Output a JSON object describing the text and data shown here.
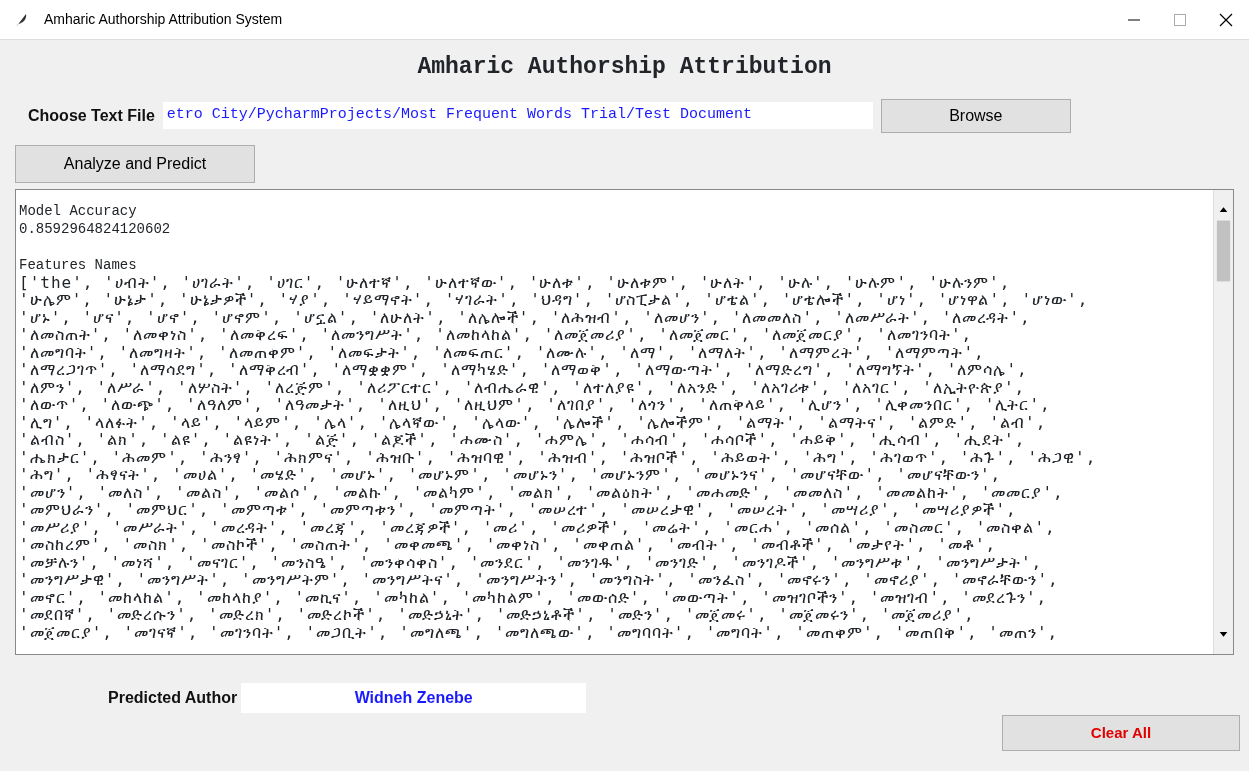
{
  "window": {
    "title": "Amharic Authorship Attribution System"
  },
  "heading": "Amharic Authorship Attribution",
  "file_row": {
    "label": "Choose Text File",
    "value": "etro City/PycharmProjects/Most Frequent Words Trial/Test Document",
    "button": "Browse"
  },
  "analyze_button": "Analyze and Predict",
  "output": [
    {
      "heading": "Model Accuracy",
      "lines": [
        "0.8592964824120602"
      ]
    },
    {
      "heading": "Features Names",
      "lines": [
        "['the', 'ሀብት', 'ሀገራት', 'ሀገር', 'ሁለተኛ', 'ሁለተኛው', 'ሁለቱ', 'ሁለቱም', 'ሁለት', 'ሁሉ', 'ሁሉም', 'ሁሉንም',",
        "'ሁሌም', 'ሁኔታ', 'ሁኔታዎች', 'ሃያ', 'ሃይማኖት', 'ሃገራት', 'ህዳግ', 'ሆስፒታል', 'ሆቴል', 'ሆቴሎች', 'ሆነ', 'ሆነዋል', 'ሆነው',",
        "'ሆኑ', 'ሆና', 'ሆኖ', 'ሆኖም', 'ሆኗል', 'ለሁለት', 'ለሌሎች', 'ለሕዝብ', 'ለመሆን', 'ለመመለስ', 'ለመሥራት', 'ለመረዳት',",
        "'ለመስጠት', 'ለመቀነስ', 'ለመቅረፍ', 'ለመንግሥት', 'ለመከላከል', 'ለመጀመሪያ', 'ለመጀመር', 'ለመጀመርያ', 'ለመገንባት',",
        "'ለመግባት', 'ለመግዛት', 'ለመጠቀም', 'ለመፍታት', 'ለመፍጠር', 'ለሙሉ', 'ለማ', 'ለማለት', 'ለማምረት', 'ለማምጣት',",
        "'ለማረጋገጥ', 'ለማሳደግ', 'ለማቅረብ', 'ለማቋቋም', 'ለማካሄድ', 'ለማወቅ', 'ለማውጣት', 'ለማድረግ', 'ለማግኘት', 'ለምሳሌ',",
        "'ለምን', 'ለሥራ', 'ለሦስት', 'ለረጅም', 'ለሪፖርተር', 'ለብሔራዊ', 'ለተለያዩ', 'ለአንድ', 'ለአገሪቱ', 'ለአገር', 'ለኢትዮጵያ',",
        "'ለውጥ', 'ለውጭ', 'ለዓለም', 'ለዓመታት', 'ለዚህ', 'ለዚህም', 'ለገበያ', 'ለጎን', 'ለጠቅላይ', 'ሊሆን', 'ሊቀመንበር', 'ሊትር',",
        "'ሊግ', 'ላለፉት', 'ላይ', 'ላይም', 'ሌላ', 'ሌላኛው', 'ሌላው', 'ሌሎች', 'ሌሎችም', 'ልማት', 'ልማትና', 'ልምድ', 'ልብ',",
        "'ልብስ', 'ልክ', 'ልዩ', 'ልዩነት', 'ልጅ', 'ልጆች', 'ሐሙስ', 'ሐምሌ', 'ሐሳብ', 'ሐሳቦች', 'ሐይቅ', 'ሒሳብ', 'ሒደት',",
        "'ሔክታር', 'ሕመም', 'ሕንፃ', 'ሕክምና', 'ሕዝቡ', 'ሕዝባዊ', 'ሕዝብ', 'ሕዝቦች', 'ሕይወት', 'ሕግ', 'ሕገወጥ', 'ሕጉ', 'ሕጋዊ',",
        "'ሕግ', 'ሕፃናት', 'መሀል', 'መሄድ', 'መሆኑ', 'መሆኑም', 'መሆኑን', 'መሆኑንም', 'መሆኑንና', 'መሆናቸው', 'መሆናቸውን',",
        "'መሆን', 'መለስ', 'መልስ', 'መልሶ', 'መልኩ', 'መልካም', 'መልክ', 'መልዕክት', 'መሐመድ', 'መመለስ', 'መመልከት', 'መመርያ',",
        "'መምህራን', 'መምህር', 'መምጣቱ', 'መምጣቱን', 'መምጣት', 'መሠረተ', 'መሠረታዊ', 'መሠረት', 'መሣሪያ', 'መሣሪያዎች',",
        "'መሥሪያ', 'መሥራት', 'መረዳት', 'መረጃ', 'መረጃዎች', 'መሪ', 'መሪዎች', 'መሬት', 'መርሐ', 'መሰል', 'መስመር', 'መስቀል',",
        "'መስከረም', 'መስክ', 'መስኮች', 'መስጠት', 'መቀመጫ', 'መቀነስ', 'መቀጠል', 'መብት', 'መብቶች', 'መታየት', 'መቶ',",
        "'መቻሉን', 'መነሻ', 'መናገር', 'መንስዔ', 'መንቀሳቀስ', 'መንደር', 'መንገዱ', 'መንገድ', 'መንገዶች', 'መንግሥቱ', 'መንግሥታት',",
        "'መንግሥታዊ', 'መንግሥት', 'መንግሥትም', 'መንግሥትና', 'መንግሥትን', 'መንግስት', 'መንፈስ', 'መኖሩን', 'መኖሪያ', 'መኖራቸውን',",
        "'መኖር', 'መከላከል', 'መከላከያ', 'መኪና', 'መካከል', 'መካከልም', 'መውሰድ', 'መውጣት', 'መዝገቦችን', 'መዝገብ', 'መደረጉን',",
        "'መደበኛ', 'መድረሱን', 'መድረክ', 'መድረኮች', 'መድኃኒት', 'መድኃኒቶች', 'መድን', 'መጀመሩ', 'መጀመሩን', 'መጀመሪያ',",
        "'መጀመርያ', 'መገናኛ', 'መገንባት', 'መጋቢት', 'መግለጫ', 'መግለጫው', 'መግባባት', 'መግባት', 'መጠቀም', 'መጠበቅ', 'መጠን',"
      ]
    }
  ],
  "result": {
    "label": "Predicted Author",
    "value": "Widneh Zenebe"
  },
  "clear_button": "Clear All"
}
